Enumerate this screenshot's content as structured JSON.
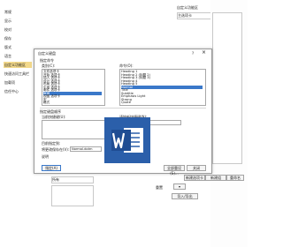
{
  "nav": {
    "items": [
      {
        "label": "常规"
      },
      {
        "label": "显示"
      },
      {
        "label": "校对"
      },
      {
        "label": "保存"
      },
      {
        "label": "版式"
      },
      {
        "label": "语言"
      },
      {
        "label": "自定义功能区",
        "selected": true
      },
      {
        "label": "快速访问工具栏"
      },
      {
        "label": "加载项"
      },
      {
        "label": "信任中心"
      }
    ]
  },
  "background": {
    "ribbon_label": "自定义功能区",
    "dropdown_value": "主选项卡",
    "bottom_dropdown": "所有",
    "new_button": "新建组",
    "rename_button": "重命名",
    "import_button": "导入/导出",
    "reset_button": "重置",
    "side_button": "新建选项卡"
  },
  "dialog": {
    "title": "自定义键盘",
    "commands_section": "指定命令",
    "categories_label": "类别(C):",
    "categories": [
      {
        "label": "文件选项卡"
      },
      {
        "label": "开始 选项卡"
      },
      {
        "label": "插入 选项卡"
      },
      {
        "label": "设计 选项卡"
      },
      {
        "label": "布局 选项卡"
      },
      {
        "label": "引用 选项卡"
      },
      {
        "label": "邮件 选项卡"
      },
      {
        "label": "审阅",
        "selected": true
      },
      {
        "label": "视图 选项卡"
      },
      {
        "label": "宏"
      },
      {
        "label": "格式"
      }
    ],
    "commands_label": "命令(O):",
    "commands": [
      {
        "label": "Heading 1"
      },
      {
        "label": "Heading 2 (标题 2)"
      },
      {
        "label": "Heading 3 (标题 3)"
      },
      {
        "label": "Heading 4"
      },
      {
        "label": "Heading 5"
      },
      {
        "label": "Normal",
        "selected": true
      },
      {
        "label": "Title"
      },
      {
        "label": "Subtitle"
      },
      {
        "label": "Emphasis Light"
      },
      {
        "label": "Strong"
      },
      {
        "label": "Quote"
      }
    ],
    "keys_section": "指定键盘顺序",
    "current_keys_label": "当前快捷键(U):",
    "new_key_label": "请按新快捷键(N):",
    "new_key_value": "Alt+Q",
    "current_keys": [],
    "current_assign_label": "目前指定到:",
    "save_in_label": "将更改保存在(V):",
    "save_in_value": "Normal.dotm",
    "description_label": "说明",
    "assign_button": "指定(A)",
    "remove_button": "删除(R)",
    "reset_button": "全部重设(S)...",
    "close_button": "关闭",
    "help_button": "?",
    "close_icon": "close-icon"
  },
  "colors": {
    "accent": "#3a78c9",
    "nav_selected": "#f3d98b",
    "word_blue": "#2b5faa"
  }
}
